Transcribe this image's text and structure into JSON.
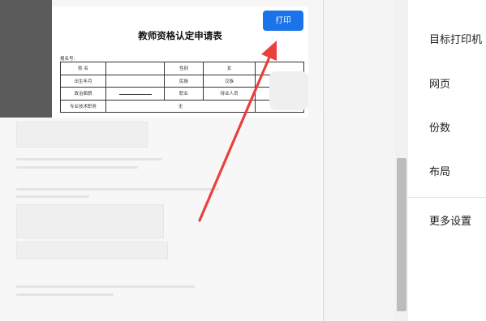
{
  "document": {
    "title": "教师资格认定申请表",
    "registration_label": "报名号:",
    "rows": [
      [
        "姓  名",
        "",
        "性别",
        "女",
        ""
      ],
      [
        "出生年月",
        "",
        "民族",
        "汉族",
        ""
      ],
      [
        "政治面貌",
        "",
        "职业",
        "待业人员",
        ""
      ],
      [
        "专业技术职务",
        "无",
        "",
        "",
        ""
      ]
    ]
  },
  "print_button": {
    "label": "打印",
    "color": "#1a73e8"
  },
  "settings": {
    "items": [
      {
        "label": "目标打印机"
      },
      {
        "label": "网页"
      },
      {
        "label": "份数"
      },
      {
        "label": "布局"
      },
      {
        "label": "更多设置"
      }
    ]
  },
  "annotation": {
    "color": "#e8413c",
    "icon": "red-arrow-icon"
  }
}
